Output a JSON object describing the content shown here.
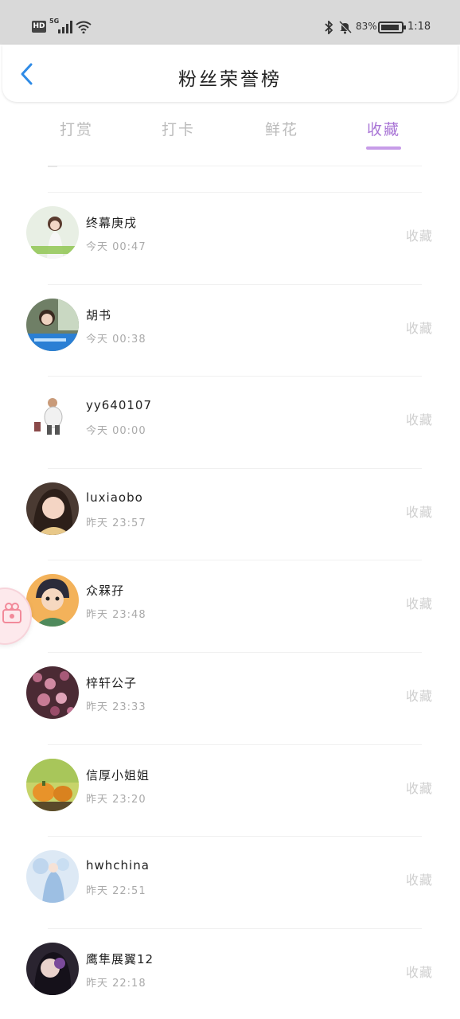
{
  "status_bar": {
    "hd": "HD",
    "network": "5G",
    "battery_percent": "83%",
    "time": "1:18"
  },
  "header": {
    "title": "粉丝荣誉榜",
    "back_icon": "chevron-left-icon"
  },
  "tabs": [
    {
      "label": "打赏",
      "active": false
    },
    {
      "label": "打卡",
      "active": false
    },
    {
      "label": "鲜花",
      "active": false
    },
    {
      "label": "收藏",
      "active": true
    }
  ],
  "list": [
    {
      "name": "终幕庚戌",
      "time": "今天 00:47",
      "action": "收藏"
    },
    {
      "name": "胡书",
      "time": "今天 00:38",
      "action": "收藏"
    },
    {
      "name": "yy640107",
      "time": "今天 00:00",
      "action": "收藏"
    },
    {
      "name": "luxiaobo",
      "time": "昨天 23:57",
      "action": "收藏"
    },
    {
      "name": "众槑孖",
      "time": "昨天 23:48",
      "action": "收藏"
    },
    {
      "name": "梓轩公子",
      "time": "昨天 23:33",
      "action": "收藏"
    },
    {
      "name": "信厚小姐姐",
      "time": "昨天 23:20",
      "action": "收藏"
    },
    {
      "name": "hwhchina",
      "time": "昨天 22:51",
      "action": "收藏"
    },
    {
      "name": "鹰隼展翼12",
      "time": "昨天 22:18",
      "action": "收藏"
    }
  ],
  "colors": {
    "accent": "#a975d6",
    "underline": "#c79ce8",
    "back_arrow": "#2f8be6",
    "muted": "#cfcfcf"
  }
}
